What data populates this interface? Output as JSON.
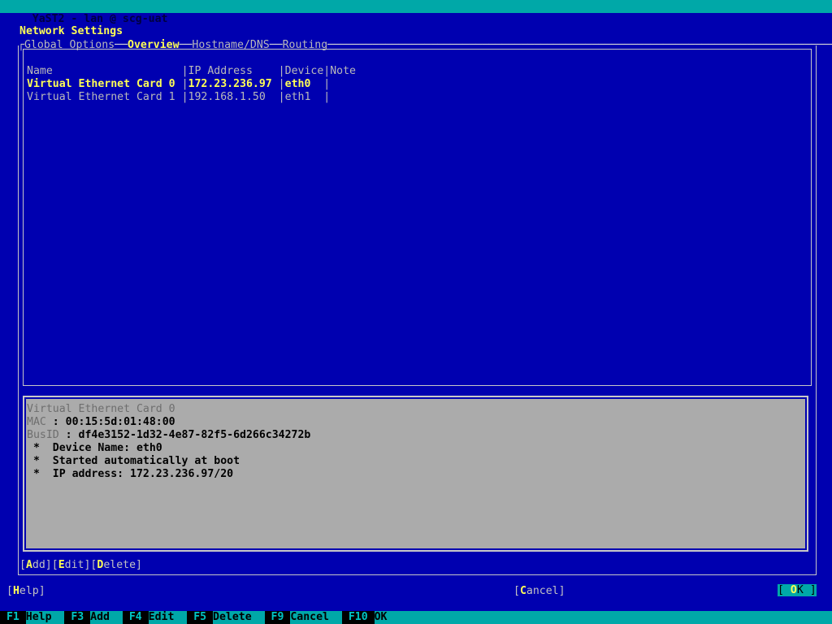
{
  "titlebar": {
    "text": "YaST2 - lan @ scg-uat"
  },
  "headline": {
    "text": "Network Settings"
  },
  "tabs": {
    "left_corner": "┌",
    "items": [
      {
        "label": "Global Options",
        "active": false
      },
      {
        "label": "Overview",
        "active": true
      },
      {
        "label": "Hostname/DNS",
        "active": false
      },
      {
        "label": "Routing",
        "active": false
      }
    ],
    "separator": "──",
    "fill": "─────────────────────────────────────────────────────────────────────────────────────"
  },
  "table": {
    "columns": [
      {
        "header": "Name",
        "width": 24
      },
      {
        "header": "IP Address",
        "width": 14
      },
      {
        "header": "Device",
        "width": 6
      },
      {
        "header": "Note",
        "width": 6
      }
    ],
    "rows": [
      {
        "selected": true,
        "cells": [
          "Virtual Ethernet Card 0",
          "172.23.236.97",
          "eth0",
          ""
        ]
      },
      {
        "selected": false,
        "cells": [
          "Virtual Ethernet Card 1",
          "192.168.1.50",
          "eth1",
          ""
        ]
      }
    ]
  },
  "detail": {
    "title": "Virtual Ethernet Card 0",
    "fields": [
      {
        "label": "MAC",
        "value": "00:15:5d:01:48:00"
      },
      {
        "label": "BusID",
        "value": "df4e3152-1d32-4e87-82f5-6d266c34272b"
      }
    ],
    "bullets": [
      "Device Name: eth0",
      "Started automatically at boot",
      "IP address: 172.23.236.97/20"
    ],
    "bullet_glyph": "*"
  },
  "buttons": {
    "add": {
      "label": "Add",
      "hotkey_index": 0,
      "focused": false
    },
    "edit": {
      "label": "Edit",
      "hotkey_index": 0,
      "focused": false
    },
    "delete": {
      "label": "Delete",
      "hotkey_index": 0,
      "focused": false
    },
    "help": {
      "label": "Help",
      "hotkey_index": 0,
      "focused": false
    },
    "cancel": {
      "label": "Cancel",
      "hotkey_index": 0,
      "focused": false
    },
    "ok": {
      "label": "OK",
      "hotkey_index": 0,
      "focused": true
    }
  },
  "fkeys": [
    {
      "key": "F1",
      "label": "Help"
    },
    {
      "key": "F3",
      "label": "Add"
    },
    {
      "key": "F4",
      "label": "Edit"
    },
    {
      "key": "F5",
      "label": "Delete"
    },
    {
      "key": "F9",
      "label": "Cancel"
    },
    {
      "key": "F10",
      "label": "OK"
    }
  ],
  "colors": {
    "background": "#0000b0",
    "accent_cyan": "#00a8a8",
    "highlight_yellow": "#ffff55",
    "frame_gray": "#c6c6c6",
    "panel_gray": "#ababab",
    "text_gray": "#b9b9b9"
  }
}
